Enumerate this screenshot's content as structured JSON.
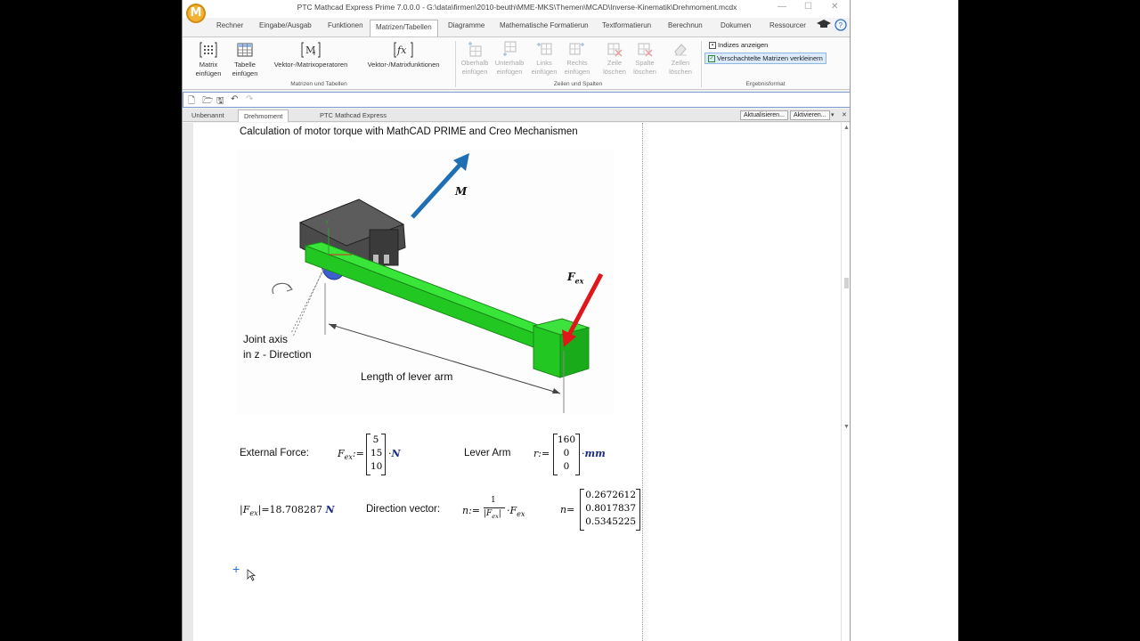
{
  "window": {
    "title": "PTC Mathcad Express Prime 7.0.0.0 - G:\\data\\firmen\\2010-beuth\\MME-MKS\\Themen\\MCAD\\Inverse-Kinematik\\Drehmoment.mcdx",
    "logo_letter": "M"
  },
  "ribbon_tabs": [
    "Rechner",
    "Eingabe/Ausgab",
    "Funktionen",
    "Matrizen/Tabellen",
    "Diagramme",
    "Mathematische Formatierun",
    "Textformatierun",
    "Berechnun",
    "Dokumen",
    "Ressourcer"
  ],
  "ribbon": {
    "matrix_insert": "Matrix\neinfügen",
    "table_insert": "Tabelle\neinfügen",
    "vector_ops": "Vektor-/Matrixoperatoren",
    "vector_funcs": "Vektor-/Matrixfunktionen",
    "group1": "Matrizen und Tabellen",
    "above": "Oberhalb\neinfügen",
    "below": "Unterhalb\neinfügen",
    "left": "Links\neinfügen",
    "right": "Rechts\neinfügen",
    "delete_row": "Zeile\nlöschen",
    "delete_col": "Spalte\nlöschen",
    "delete_cells": "Zellen\nlöschen",
    "group2": "Zeilen und Spalten",
    "show_indices": "Indizes anzeigen",
    "nested_matrices": "Verschachtelte Matrizen verkleinern",
    "group3": "Ergebnisformat"
  },
  "doc_tabs": {
    "tab1": "Unbenannt",
    "tab2": "Drehmoment",
    "app": "PTC Mathcad Express",
    "update_btn": "Aktualisieren...",
    "activate_btn": "Aktivieren..."
  },
  "sheet": {
    "title": "Calculation of motor torque with MathCAD PRIME and Creo Mechanismen",
    "figure": {
      "moment_label": "M",
      "force_label": "F",
      "force_sub": "ex",
      "joint_axis_1": "Joint axis",
      "joint_axis_2": "in z - Direction",
      "lever_length": "Length of lever arm"
    },
    "ext_force_label": "External Force:",
    "fex_values": [
      "5",
      "15",
      "10"
    ],
    "fex_unit": "N",
    "lever_arm_label": "Lever Arm",
    "r_values": [
      "160",
      "0",
      "0"
    ],
    "r_unit": "mm",
    "norm_result": "18.708287",
    "norm_unit": "N",
    "direction_label": "Direction vector:",
    "n_values": [
      "0.2672612",
      "0.8017837",
      "0.5345225"
    ]
  },
  "colors": {
    "lever_green": "#2ee22e",
    "moment_arrow": "#1f6fb5",
    "force_arrow": "#e0161a",
    "unit_blue": "#1a2c8a"
  }
}
